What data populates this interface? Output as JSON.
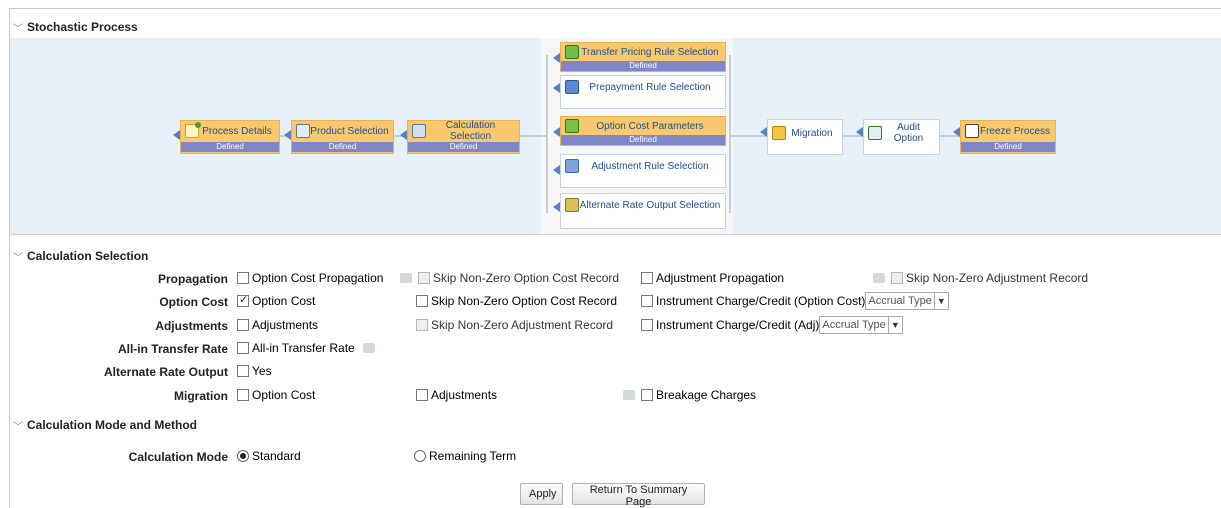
{
  "sections": {
    "stochastic": "Stochastic Process",
    "calc_selection": "Calculation Selection",
    "calc_mode_method": "Calculation Mode and Method"
  },
  "flow": {
    "process_details": {
      "label": "Process Details",
      "status": "Defined"
    },
    "product_selection": {
      "label": "Product Selection",
      "status": "Defined"
    },
    "calculation_selection": {
      "label": "Calculation Selection",
      "status": "Defined"
    },
    "transfer_pricing": {
      "label": "Transfer Pricing Rule Selection",
      "status": "Defined"
    },
    "prepayment": {
      "label": "Prepayment Rule Selection"
    },
    "option_cost_params": {
      "label": "Option Cost Parameters",
      "status": "Defined"
    },
    "adjustment_rule": {
      "label": "Adjustment Rule Selection"
    },
    "alternate_rate": {
      "label": "Alternate Rate Output Selection"
    },
    "migration": {
      "label": "Migration"
    },
    "audit_option": {
      "label": "Audit Option"
    },
    "freeze_process": {
      "label": "Freeze Process",
      "status": "Defined"
    }
  },
  "calc": {
    "propagation": {
      "label": "Propagation",
      "option_cost_propagation": "Option Cost Propagation",
      "skip_nonzero_option": "Skip Non-Zero Option Cost Record",
      "adjustment_propagation": "Adjustment Propagation",
      "skip_nonzero_adjustment": "Skip Non-Zero Adjustment Record"
    },
    "option_cost": {
      "label": "Option Cost",
      "option_cost": "Option Cost",
      "option_cost_checked": true,
      "skip_nonzero_option": "Skip Non-Zero Option Cost Record",
      "instrument_charge": "Instrument Charge/Credit (Option Cost)",
      "accrual_type": "Accrual Type"
    },
    "adjustments": {
      "label": "Adjustments",
      "adjustments": "Adjustments",
      "skip_nonzero_adjustment": "Skip Non-Zero Adjustment Record",
      "instrument_charge": "Instrument Charge/Credit (Adj)",
      "accrual_type": "Accrual Type"
    },
    "all_in": {
      "label": "All-in Transfer Rate",
      "option": "All-in Transfer Rate"
    },
    "alternate_rate": {
      "label": "Alternate Rate Output",
      "option": "Yes"
    },
    "migration": {
      "label": "Migration",
      "option_cost": "Option Cost",
      "adjustments": "Adjustments",
      "breakage_charges": "Breakage Charges"
    }
  },
  "mode": {
    "label": "Calculation Mode",
    "standard": "Standard",
    "remaining_term": "Remaining Term",
    "selected": "Standard"
  },
  "buttons": {
    "apply": "Apply",
    "return": "Return To Summary Page"
  },
  "colors": {
    "defined_node": "#f8c86e",
    "status_bar": "#7f86c9",
    "flow_bg": "#e5f0f8",
    "link_text": "#1f4f8f"
  }
}
